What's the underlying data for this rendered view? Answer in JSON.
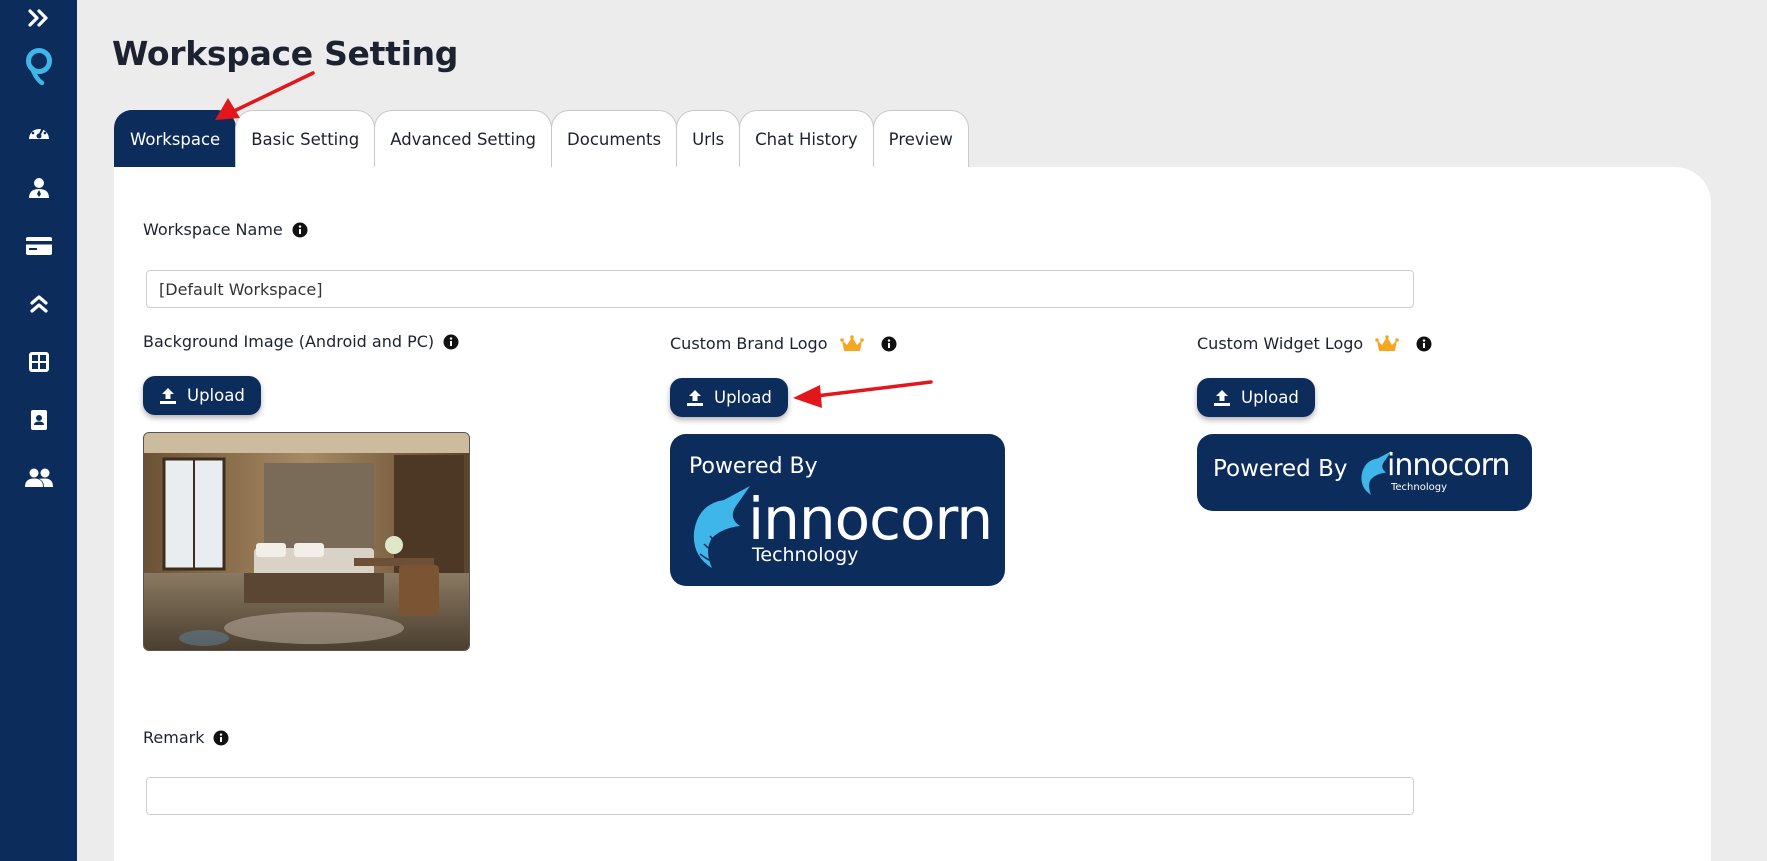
{
  "colors": {
    "primary": "#0c2d5c",
    "accent_light_blue": "#3fb6ea",
    "arrow": "#e3161b",
    "crown": "#f5a623"
  },
  "sidebar": {
    "items": [
      {
        "icon": "double-chevron-right-icon"
      },
      {
        "icon": "app-logo-icon"
      },
      {
        "icon": "dashboard-gauge-icon"
      },
      {
        "icon": "user-icon"
      },
      {
        "icon": "credit-card-icon"
      },
      {
        "icon": "double-chevron-up-icon"
      },
      {
        "icon": "plus-square-icon"
      },
      {
        "icon": "contact-card-icon"
      },
      {
        "icon": "users-icon"
      }
    ]
  },
  "page": {
    "title": "Workspace Setting"
  },
  "tabs": [
    {
      "label": "Workspace",
      "active": true
    },
    {
      "label": "Basic Setting"
    },
    {
      "label": "Advanced Setting"
    },
    {
      "label": "Documents"
    },
    {
      "label": "Urls"
    },
    {
      "label": "Chat History"
    },
    {
      "label": "Preview"
    }
  ],
  "form": {
    "workspace_name": {
      "label": "Workspace Name",
      "value": "[Default Workspace]"
    },
    "background_image": {
      "label": "Background Image (Android and PC)",
      "button": "Upload"
    },
    "brand_logo": {
      "label": "Custom Brand Logo",
      "button": "Upload",
      "powered_by": "Powered By",
      "brand": "innocorn",
      "tech": "Technology"
    },
    "widget_logo": {
      "label": "Custom Widget Logo",
      "button": "Upload",
      "powered_by": "Powered By",
      "brand": "innocorn",
      "tech": "Technology"
    },
    "remark": {
      "label": "Remark",
      "value": ""
    }
  }
}
